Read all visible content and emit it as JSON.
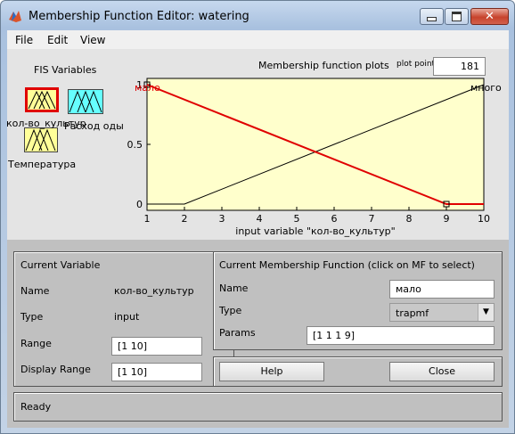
{
  "window": {
    "title": "Membership Function Editor: watering"
  },
  "menu": [
    "File",
    "Edit",
    "View"
  ],
  "fis": {
    "heading": "FIS Variables",
    "inputs": [
      "кол-во_культур",
      "Температура"
    ],
    "output": "Расход_воды",
    "output_display": "Расход оды"
  },
  "plot": {
    "title": "Membership function plots",
    "points_label": "plot points",
    "points_value": "181",
    "xlabel": "input variable \"кол-во_культур\"",
    "mf_labels": {
      "left": "мало",
      "right": "много"
    },
    "colors": {
      "selected": "#e00000",
      "other": "#000000",
      "bg": "#ffffcc"
    }
  },
  "chart_data": {
    "type": "line",
    "xlabel": "input variable \"кол-во_культур\"",
    "xlim": [
      1,
      10
    ],
    "ylim": [
      0,
      1
    ],
    "xticks": [
      "1",
      "2",
      "3",
      "4",
      "5",
      "6",
      "7",
      "8",
      "9",
      "10"
    ],
    "yticks": [
      "0",
      "0.5",
      "1"
    ],
    "series": [
      {
        "name": "мало",
        "type": "trapmf",
        "x": [
          1,
          1,
          1,
          9,
          10
        ],
        "y": [
          1,
          1,
          1,
          0,
          0
        ],
        "selected": true
      },
      {
        "name": "много",
        "type": "trapmf",
        "x": [
          1,
          2,
          10,
          10
        ],
        "y": [
          0,
          0,
          1,
          1
        ],
        "selected": false
      }
    ]
  },
  "current_variable": {
    "heading": "Current Variable",
    "name_label": "Name",
    "name_value": "кол-во_культур",
    "type_label": "Type",
    "type_value": "input",
    "range_label": "Range",
    "range_value": "[1 10]",
    "display_range_label": "Display Range",
    "display_range_value": "[1 10]"
  },
  "current_mf": {
    "heading": "Current Membership Function (click on MF to select)",
    "name_label": "Name",
    "name_value": "мало",
    "type_label": "Type",
    "type_value": "trapmf",
    "params_label": "Params",
    "params_value": "[1 1 1 9]"
  },
  "buttons": {
    "help": "Help",
    "close": "Close"
  },
  "status": "Ready"
}
